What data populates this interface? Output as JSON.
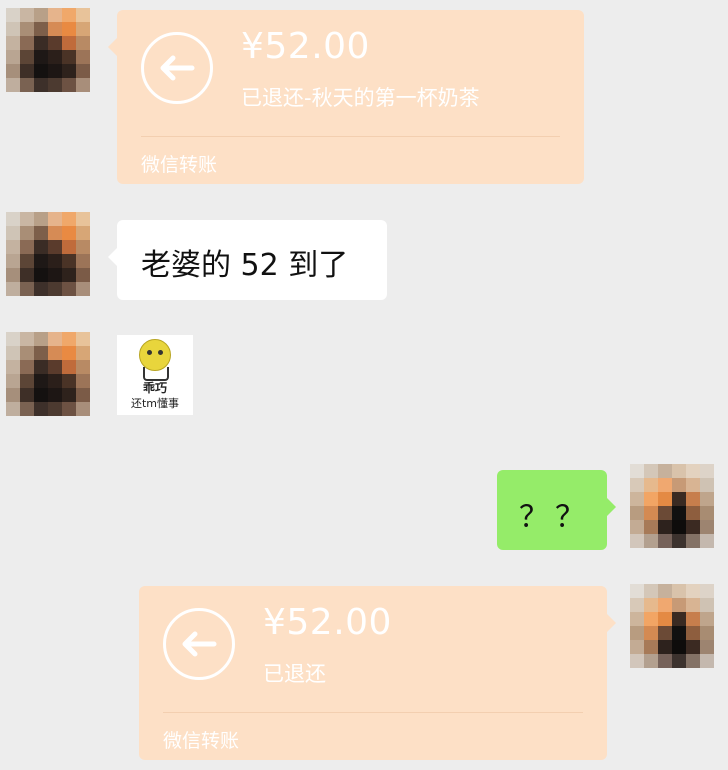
{
  "colors": {
    "background": "#ededed",
    "transfer_bubble": "#fde0c6",
    "sent_bubble": "#95ec69",
    "received_bubble": "#ffffff"
  },
  "messages": [
    {
      "type": "transfer",
      "side": "left",
      "icon": "return-arrow-icon",
      "amount": "¥52.00",
      "status": "已退还-秋天的第一杯奶茶",
      "footer": "微信转账"
    },
    {
      "type": "text",
      "side": "left",
      "text": "老婆的 52 到了"
    },
    {
      "type": "sticker",
      "side": "left",
      "line1": "乖巧",
      "line2": "还tm懂事"
    },
    {
      "type": "text",
      "side": "right",
      "text": "？？"
    },
    {
      "type": "transfer",
      "side": "right",
      "icon": "return-arrow-icon",
      "amount": "¥52.00",
      "status": "已退还",
      "footer": "微信转账"
    }
  ]
}
